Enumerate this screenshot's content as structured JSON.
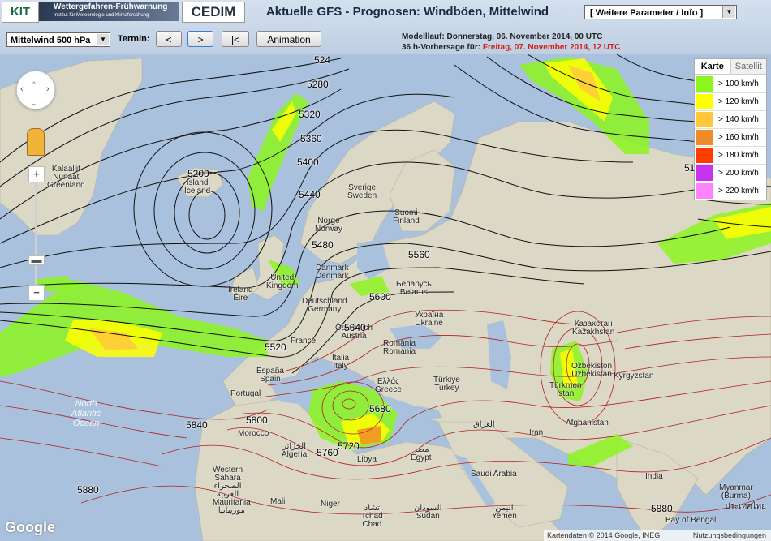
{
  "header": {
    "logo_kit": "KIT",
    "logo_wf_title": "Wettergefahren-Frühwarnung",
    "logo_wf_sub": "Institut für Meteorologie und Klimaforschung",
    "logo_cedim": "CEDIM",
    "title": "Aktuelle GFS - Prognosen: Windböen, Mittelwind",
    "param_select": "[ Weitere Parameter / Info ]"
  },
  "toolbar": {
    "level_select": "Mittelwind 500 hPa",
    "termin_label": "Termin:",
    "prev_btn": "<",
    "next_btn": ">",
    "first_btn": "|<",
    "animation_btn": "Animation",
    "run_label": "Modelllauf: Donnerstag, 06. November 2014, 00 UTC",
    "forecast_prefix": "36 h-Vorhersage für:",
    "forecast_time": "Freitag, 07. November 2014, 12 UTC"
  },
  "legend": {
    "tab_map": "Karte",
    "tab_sat": "Satellit",
    "items": [
      {
        "label": "> 100 km/h",
        "color": "#8cf51e"
      },
      {
        "label": "> 120 km/h",
        "color": "#ffff00"
      },
      {
        "label": "> 140 km/h",
        "color": "#ffc83c"
      },
      {
        "label": "> 160 km/h",
        "color": "#f08c28"
      },
      {
        "label": "> 180 km/h",
        "color": "#ff3c00"
      },
      {
        "label": "> 200 km/h",
        "color": "#c832f0"
      },
      {
        "label": "> 220 km/h",
        "color": "#ff82ff"
      }
    ]
  },
  "map": {
    "countries": [
      {
        "id": "greenland",
        "text": "Kalaallit\nNunaat\nGreenland"
      },
      {
        "id": "iceland",
        "text": "Ísland\nIceland"
      },
      {
        "id": "sweden",
        "text": "Sverige\nSweden"
      },
      {
        "id": "finland",
        "text": "Suomi\nFinland"
      },
      {
        "id": "norway",
        "text": "Norge\nNorway"
      },
      {
        "id": "denmark",
        "text": "Danmark\nDenmark"
      },
      {
        "id": "ireland",
        "text": "Ireland\nÉire"
      },
      {
        "id": "uk",
        "text": "United\nKingdom"
      },
      {
        "id": "belarus",
        "text": "Беларусь\nBelarus"
      },
      {
        "id": "germany",
        "text": "Deutschland\nGermany"
      },
      {
        "id": "ukraine",
        "text": "Україна\nUkraine"
      },
      {
        "id": "france",
        "text": "France"
      },
      {
        "id": "austria",
        "text": "Österreich\nAustria"
      },
      {
        "id": "romania",
        "text": "România\nRomania"
      },
      {
        "id": "kazakhstan",
        "text": "Казахстан\nKazakhstan"
      },
      {
        "id": "italy",
        "text": "Italia\nItaly"
      },
      {
        "id": "spain",
        "text": "España\nSpain"
      },
      {
        "id": "portugal",
        "text": "Portugal"
      },
      {
        "id": "greece",
        "text": "Ελλάς\nGreece"
      },
      {
        "id": "turkey",
        "text": "Türkiye\nTurkey"
      },
      {
        "id": "uzbekistan",
        "text": "Ozbekiston\nUzbekistan"
      },
      {
        "id": "kyrgyzstan",
        "text": "Kyrgyzstan"
      },
      {
        "id": "turkmenistan",
        "text": "Türkmen\nistan"
      },
      {
        "id": "afghanistan",
        "text": "Afghanistan"
      },
      {
        "id": "iran",
        "text": "Iran"
      },
      {
        "id": "morocco",
        "text": "Morocco"
      },
      {
        "id": "algeria",
        "text": "الجزائر\nAlgeria"
      },
      {
        "id": "libya",
        "text": "Libya"
      },
      {
        "id": "egypt",
        "text": "مصر\nEgypt"
      },
      {
        "id": "saudi",
        "text": "Saudi Arabia"
      },
      {
        "id": "iraq",
        "text": "العراق"
      },
      {
        "id": "india",
        "text": "India"
      },
      {
        "id": "sahara",
        "text": "Western\nSahara\nالصحراء\nالغربية"
      },
      {
        "id": "mauritania",
        "text": "Mauritania\nموريتانيا"
      },
      {
        "id": "mali",
        "text": "Mali"
      },
      {
        "id": "niger",
        "text": "Niger"
      },
      {
        "id": "chad",
        "text": "تشاد\nTchad\nChad"
      },
      {
        "id": "sudan",
        "text": "السودان\nSudan"
      },
      {
        "id": "yemen",
        "text": "اليمن\nYemen"
      },
      {
        "id": "myanmar",
        "text": "Myanmar\n(Burma)"
      },
      {
        "id": "thailand",
        "text": "ประเทศไทย"
      },
      {
        "id": "bay",
        "text": "Bay of Bengal"
      }
    ],
    "oceans": [
      {
        "id": "north-atlantic",
        "text": "North\nAtlantic\nOcean"
      }
    ],
    "contour_labels": [
      "524",
      "5280",
      "5320",
      "5360",
      "5400",
      "5440",
      "5480",
      "5520",
      "5560",
      "5600",
      "5640",
      "5680",
      "5720",
      "5760",
      "5800",
      "5840",
      "5880",
      "51",
      "5880",
      "5200"
    ],
    "zoom_in": "+",
    "zoom_out": "−",
    "google_label": "Google",
    "attribution": "Kartendaten © 2014 Google, INEGI",
    "terms": "Nutzungsbedingungen"
  }
}
